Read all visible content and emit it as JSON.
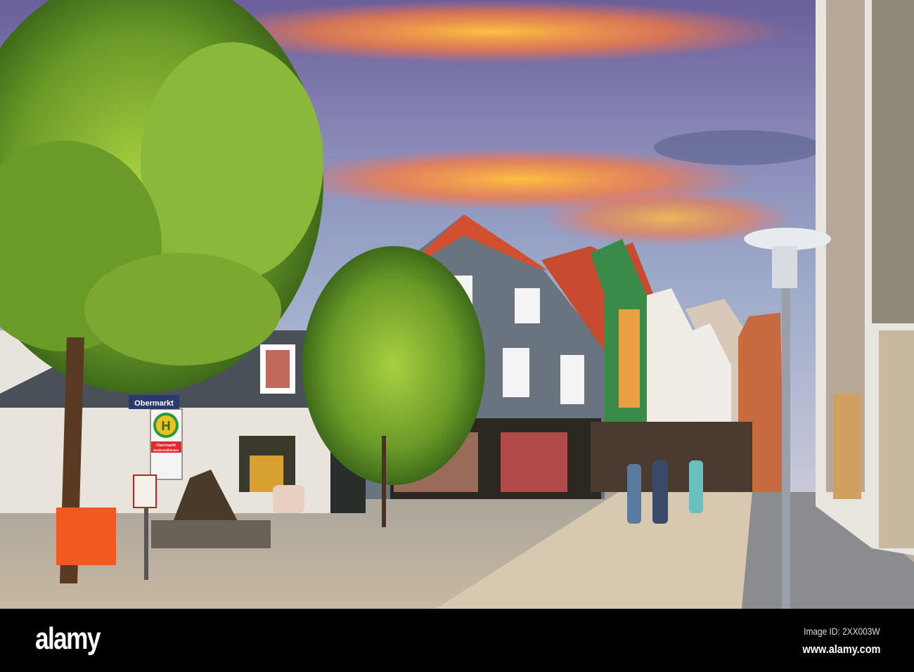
{
  "scene": {
    "street_sign": "Obermarkt",
    "bus_stop": {
      "symbol": "H",
      "line1": "Obermarkt",
      "line2": "Stadtrundfahrten"
    },
    "colors": {
      "sky_top": "#5a6aa0",
      "sunset": "#ff9a3a",
      "roof": "#d2502f",
      "tree": "#7ab32a",
      "slate": "#5f6870"
    }
  },
  "watermark": {
    "logo": "alamy",
    "image_id": "Image ID: 2XX003W",
    "url": "www.alamy.com"
  }
}
